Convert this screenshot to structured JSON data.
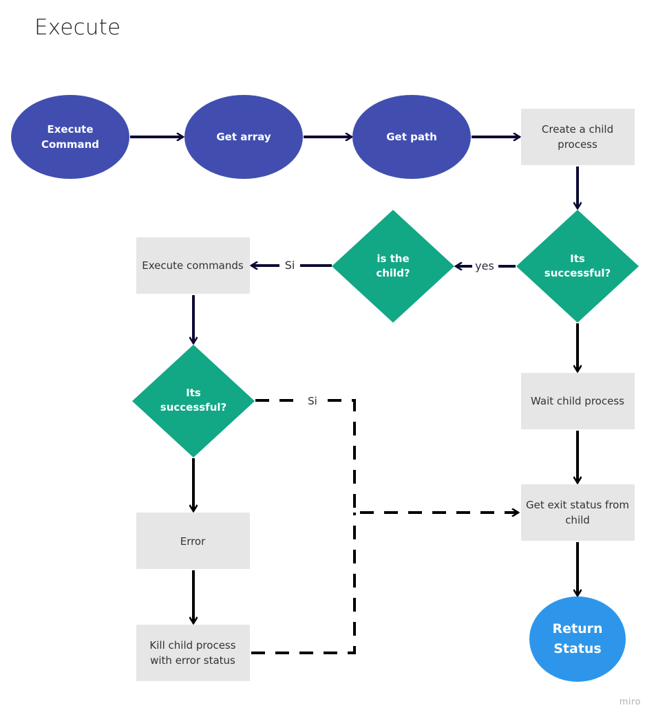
{
  "title": "Execute",
  "watermark": "miro",
  "colors": {
    "terminal_fill": "#414eb0",
    "decision_fill": "#12a785",
    "process_fill": "#e6e6e6",
    "end_fill": "#2e96ea",
    "arrow_navy": "#0d0b33",
    "arrow_black": "#000000"
  },
  "nodes": {
    "execute_command": {
      "shape": "ellipse",
      "lines": [
        "Execute",
        "Command"
      ]
    },
    "get_array": {
      "shape": "ellipse",
      "lines": [
        "Get array"
      ]
    },
    "get_path": {
      "shape": "ellipse",
      "lines": [
        "Get path"
      ]
    },
    "create_child": {
      "shape": "rect",
      "lines": [
        "Create a child",
        "process"
      ]
    },
    "its_successful_1": {
      "shape": "diamond",
      "lines": [
        "Its",
        "successful?"
      ]
    },
    "is_the_child": {
      "shape": "diamond",
      "lines": [
        "is the",
        "child?"
      ]
    },
    "execute_commands": {
      "shape": "rect",
      "lines": [
        "Execute commands"
      ]
    },
    "its_successful_2": {
      "shape": "diamond",
      "lines": [
        "Its",
        "successful?"
      ]
    },
    "wait_child": {
      "shape": "rect",
      "lines": [
        "Wait child process"
      ]
    },
    "get_exit_status": {
      "shape": "rect",
      "lines": [
        "Get exit status from",
        "child"
      ]
    },
    "error": {
      "shape": "rect",
      "lines": [
        "Error"
      ]
    },
    "kill_child": {
      "shape": "rect",
      "lines": [
        "Kill child process",
        "with error status"
      ]
    },
    "return_status": {
      "shape": "ellipse",
      "lines": [
        "Return",
        "Status"
      ]
    }
  },
  "edges": [
    {
      "from": "execute_command",
      "to": "get_array",
      "label": "",
      "style": "solid"
    },
    {
      "from": "get_array",
      "to": "get_path",
      "label": "",
      "style": "solid"
    },
    {
      "from": "get_path",
      "to": "create_child",
      "label": "",
      "style": "solid"
    },
    {
      "from": "create_child",
      "to": "its_successful_1",
      "label": "",
      "style": "solid"
    },
    {
      "from": "its_successful_1",
      "to": "is_the_child",
      "label": "yes",
      "style": "solid"
    },
    {
      "from": "is_the_child",
      "to": "execute_commands",
      "label": "Si",
      "style": "solid"
    },
    {
      "from": "execute_commands",
      "to": "its_successful_2",
      "label": "",
      "style": "solid"
    },
    {
      "from": "its_successful_1",
      "to": "wait_child",
      "label": "",
      "style": "solid"
    },
    {
      "from": "wait_child",
      "to": "get_exit_status",
      "label": "",
      "style": "solid"
    },
    {
      "from": "its_successful_2",
      "to": "get_exit_status",
      "label": "Si",
      "style": "dashed"
    },
    {
      "from": "its_successful_2",
      "to": "error",
      "label": "",
      "style": "solid"
    },
    {
      "from": "error",
      "to": "kill_child",
      "label": "",
      "style": "solid"
    },
    {
      "from": "kill_child",
      "to": "get_exit_status",
      "label": "",
      "style": "dashed"
    },
    {
      "from": "get_exit_status",
      "to": "return_status",
      "label": "",
      "style": "solid"
    }
  ]
}
